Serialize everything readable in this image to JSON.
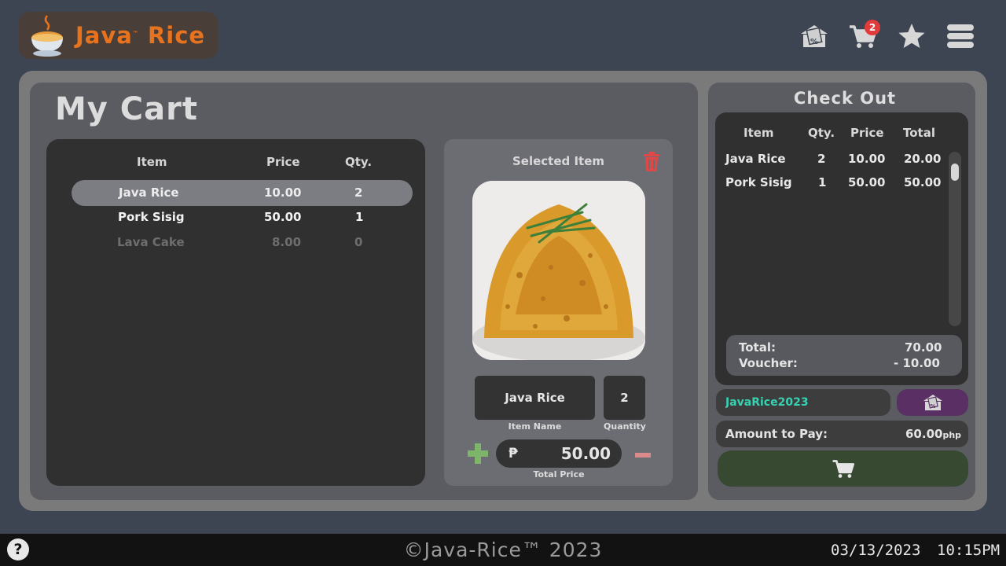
{
  "app": {
    "logo_text_a": "Java",
    "logo_tm": "™",
    "logo_text_b": "Rice"
  },
  "header": {
    "icons": [
      "voucher-icon",
      "cart-icon",
      "star-icon",
      "menu-icon"
    ],
    "cart_count": "2"
  },
  "cart": {
    "title": "My Cart",
    "columns": {
      "item": "Item",
      "price": "Price",
      "qty": "Qty."
    },
    "rows": [
      {
        "item": "Java Rice",
        "price": "10.00",
        "qty": "2",
        "state": "selected"
      },
      {
        "item": "Pork Sisig",
        "price": "50.00",
        "qty": "1",
        "state": "normal"
      },
      {
        "item": "Lava Cake",
        "price": "8.00",
        "qty": "0",
        "state": "disabled"
      }
    ]
  },
  "selected": {
    "title": "Selected Item",
    "item_name": "Java Rice",
    "quantity": "2",
    "item_name_caption": "Item Name",
    "quantity_caption": "Quantity",
    "currency_symbol": "₱",
    "total_price": "50.00",
    "total_price_caption": "Total Price"
  },
  "checkout": {
    "title": "Check Out",
    "columns": {
      "item": "Item",
      "qty": "Qty.",
      "price": "Price",
      "total": "Total"
    },
    "rows": [
      {
        "item": "Java Rice",
        "qty": "2",
        "price": "10.00",
        "total": "20.00"
      },
      {
        "item": "Pork Sisig",
        "qty": "1",
        "price": "50.00",
        "total": "50.00"
      }
    ],
    "total_label": "Total:",
    "total_value": "70.00",
    "voucher_label": "Voucher:",
    "voucher_value": "- 10.00",
    "voucher_code": "JavaRice2023",
    "amount_label": "Amount to Pay:",
    "amount_value": "60.00",
    "amount_unit": "php"
  },
  "footer": {
    "help": "?",
    "copyright": "©Java-Rice™ 2023",
    "date": "03/13/2023",
    "time": "10:15PM"
  },
  "colors": {
    "background": "#3d4452",
    "panel": "#5b5c62",
    "accent_orange": "#e8731f",
    "voucher_code": "#36d3b3",
    "checkout_button": "#374a31",
    "voucher_button": "#5a2f63",
    "badge": "#e23b3b",
    "plus": "#7fb56a",
    "minus": "#d98a8a",
    "trash": "#e04848"
  }
}
